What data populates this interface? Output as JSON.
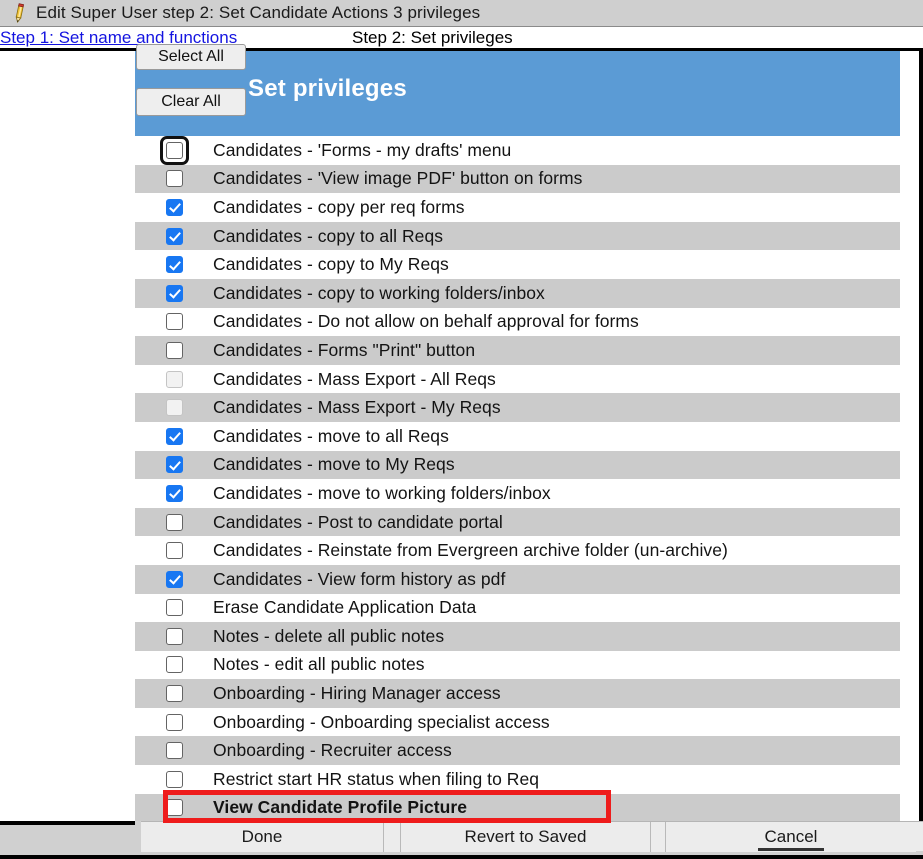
{
  "window": {
    "title": "Edit Super User step 2: Set Candidate Actions 3 privileges",
    "icon": "pencil-icon"
  },
  "steps": {
    "step1_link": "Step 1: Set name and functions",
    "step2_current": "Step 2: Set privileges"
  },
  "banner": {
    "title": "Set privileges",
    "color": "#5b9bd5"
  },
  "side_buttons": {
    "select_all": "Select All",
    "clear_all": "Clear All"
  },
  "privileges": [
    {
      "label": "Candidates - 'Forms - my drafts' menu",
      "checked": false,
      "disabled": false,
      "focused": true,
      "emphasis": false
    },
    {
      "label": "Candidates - 'View image PDF' button on forms",
      "checked": false,
      "disabled": false,
      "focused": false,
      "emphasis": false
    },
    {
      "label": "Candidates - copy per req forms",
      "checked": true,
      "disabled": false,
      "focused": false,
      "emphasis": false
    },
    {
      "label": "Candidates - copy to all Reqs",
      "checked": true,
      "disabled": false,
      "focused": false,
      "emphasis": false
    },
    {
      "label": "Candidates - copy to My Reqs",
      "checked": true,
      "disabled": false,
      "focused": false,
      "emphasis": false
    },
    {
      "label": "Candidates - copy to working folders/inbox",
      "checked": true,
      "disabled": false,
      "focused": false,
      "emphasis": false
    },
    {
      "label": "Candidates - Do not allow on behalf approval for forms",
      "checked": false,
      "disabled": false,
      "focused": false,
      "emphasis": false
    },
    {
      "label": "Candidates - Forms \"Print\" button",
      "checked": false,
      "disabled": false,
      "focused": false,
      "emphasis": false
    },
    {
      "label": "Candidates - Mass Export - All Reqs",
      "checked": false,
      "disabled": true,
      "focused": false,
      "emphasis": false
    },
    {
      "label": "Candidates - Mass Export - My Reqs",
      "checked": false,
      "disabled": true,
      "focused": false,
      "emphasis": false
    },
    {
      "label": "Candidates - move to all Reqs",
      "checked": true,
      "disabled": false,
      "focused": false,
      "emphasis": false
    },
    {
      "label": "Candidates - move to My Reqs",
      "checked": true,
      "disabled": false,
      "focused": false,
      "emphasis": false
    },
    {
      "label": "Candidates - move to working folders/inbox",
      "checked": true,
      "disabled": false,
      "focused": false,
      "emphasis": false
    },
    {
      "label": "Candidates - Post to candidate portal",
      "checked": false,
      "disabled": false,
      "focused": false,
      "emphasis": false
    },
    {
      "label": "Candidates - Reinstate from Evergreen archive folder (un-archive)",
      "checked": false,
      "disabled": false,
      "focused": false,
      "emphasis": false
    },
    {
      "label": "Candidates - View form history as pdf",
      "checked": true,
      "disabled": false,
      "focused": false,
      "emphasis": false
    },
    {
      "label": "Erase Candidate Application Data",
      "checked": false,
      "disabled": false,
      "focused": false,
      "emphasis": false
    },
    {
      "label": "Notes - delete all public notes",
      "checked": false,
      "disabled": false,
      "focused": false,
      "emphasis": false
    },
    {
      "label": "Notes - edit all public notes",
      "checked": false,
      "disabled": false,
      "focused": false,
      "emphasis": false
    },
    {
      "label": "Onboarding - Hiring Manager access",
      "checked": false,
      "disabled": false,
      "focused": false,
      "emphasis": false
    },
    {
      "label": "Onboarding - Onboarding specialist access",
      "checked": false,
      "disabled": false,
      "focused": false,
      "emphasis": false
    },
    {
      "label": "Onboarding - Recruiter access",
      "checked": false,
      "disabled": false,
      "focused": false,
      "emphasis": false
    },
    {
      "label": "Restrict start HR status when filing to Req",
      "checked": false,
      "disabled": false,
      "focused": false,
      "emphasis": false
    },
    {
      "label": "View Candidate Profile Picture",
      "checked": false,
      "disabled": false,
      "focused": false,
      "emphasis": true
    }
  ],
  "bottom_bar": {
    "done": "Done",
    "revert": "Revert to Saved",
    "cancel": "Cancel"
  },
  "annotation": {
    "highlight_color": "#ee1c1c",
    "highlight_target": "View Candidate Profile Picture"
  }
}
